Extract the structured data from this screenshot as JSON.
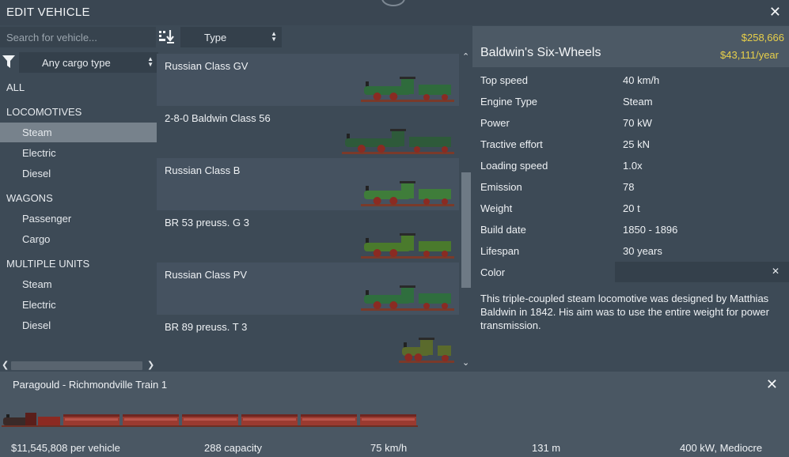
{
  "window": {
    "title": "EDIT VEHICLE"
  },
  "search": {
    "placeholder": "Search for vehicle..."
  },
  "sort": {
    "selected": "Type"
  },
  "filter": {
    "cargo": "Any cargo type"
  },
  "categories": {
    "all": "ALL",
    "locomotives": {
      "label": "LOCOMOTIVES",
      "items": [
        "Steam",
        "Electric",
        "Diesel"
      ]
    },
    "wagons": {
      "label": "WAGONS",
      "items": [
        "Passenger",
        "Cargo"
      ]
    },
    "multiple_units": {
      "label": "MULTIPLE UNITS",
      "items": [
        "Steam",
        "Electric",
        "Diesel"
      ]
    }
  },
  "vehicles": [
    {
      "name": "Russian Class GV",
      "color": "#2f6b3c"
    },
    {
      "name": "2-8-0 Baldwin Class 56",
      "color": "#2e5a3a"
    },
    {
      "name": "Russian Class B",
      "color": "#3f7d3a"
    },
    {
      "name": "BR 53 preuss. G 3",
      "color": "#4a7a2c"
    },
    {
      "name": "Russian Class PV",
      "color": "#2f6e3e"
    },
    {
      "name": "BR 89 preuss. T 3",
      "color": "#5a6a2c"
    }
  ],
  "detail": {
    "name": "Baldwin's Six-Wheels",
    "price": "$258,666",
    "running_cost": "$43,111/year",
    "props": [
      {
        "label": "Top speed",
        "value": "40 km/h"
      },
      {
        "label": "Engine Type",
        "value": "Steam"
      },
      {
        "label": "Power",
        "value": "70 kW"
      },
      {
        "label": "Tractive effort",
        "value": "25 kN"
      },
      {
        "label": "Loading speed",
        "value": "1.0x"
      },
      {
        "label": "Emission",
        "value": "78"
      },
      {
        "label": "Weight",
        "value": "20 t"
      },
      {
        "label": "Build date",
        "value": "1850 - 1896"
      },
      {
        "label": "Lifespan",
        "value": "30 years"
      }
    ],
    "color_label": "Color",
    "description": "This triple-coupled steam locomotive was designed by Matthias Baldwin in 1842. His aim was to use the entire weight for power transmission."
  },
  "train": {
    "name": "Paragould - Richmondville Train 1",
    "stats": {
      "cost": "$11,545,808 per vehicle",
      "capacity": "288 capacity",
      "speed": "75 km/h",
      "length": "131 m",
      "power": "400 kW, Mediocre"
    },
    "wagon_count": 6
  },
  "colors": {
    "accent": "#e7cf4a",
    "active_row": "#77828c"
  }
}
